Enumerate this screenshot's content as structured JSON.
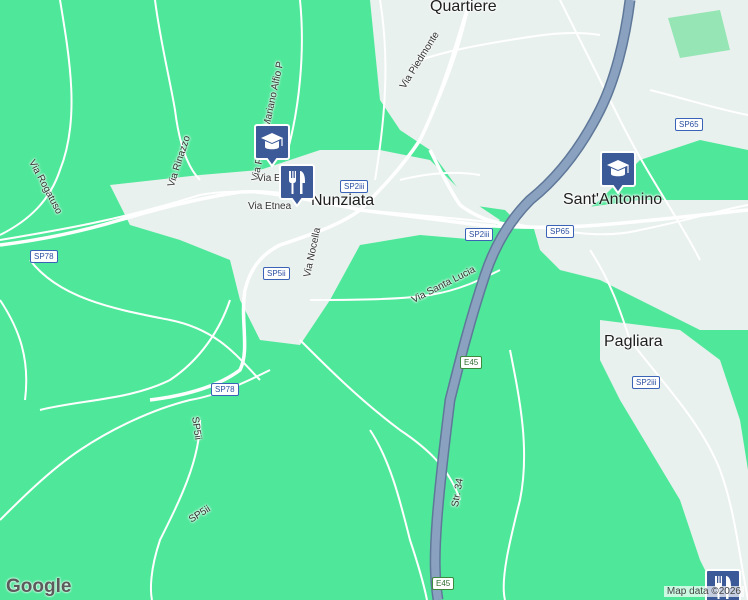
{
  "map": {
    "towns": {
      "quartiere": "Quartiere",
      "nunziata": "Nunziata",
      "sant_antonino": "Sant'Antonino",
      "pagliara": "Pagliara"
    },
    "streets": {
      "via_piedmonte": "Via Piedmonte",
      "via_rinazzo": "Via Rinazzo",
      "via_rogatuso": "Via Rogatuso",
      "via_parroco": "Via Parroco Mariano Alfio P",
      "via_etnea": "Via Etnea",
      "via_etnea_short": "Via E",
      "via_nocella": "Via Nocella",
      "via_santa_lucia": "Via Santa Lucia",
      "str_34": "Str. 34",
      "sp5ii_vertical": "SP5ii",
      "sp5ii_lower": "SP5ii"
    },
    "shields": {
      "sp2iii_top": "SP2iii",
      "sp2iii_mid": "SP2iii",
      "sp2iii_right": "SP2iii",
      "sp65_top": "SP65",
      "sp65_mid": "SP65",
      "sp78_left": "SP78",
      "sp5ii": "SP5ii",
      "sp78_mid": "SP78",
      "e45_mid": "E45",
      "e45_bottom": "E45"
    },
    "attribution": "Map data ©2026",
    "logo": "Google",
    "pins": {
      "school_nunziata": "graduation-cap-icon",
      "restaurant_nunziata": "restaurant-icon",
      "school_sant_antonino": "graduation-cap-icon",
      "restaurant_corner": "restaurant-icon"
    },
    "colors": {
      "land": "#4fe89a",
      "urban": "#e9f1ee",
      "road": "#ffffff",
      "highway": "#7e95b3",
      "pin": "#3c5a98"
    }
  }
}
